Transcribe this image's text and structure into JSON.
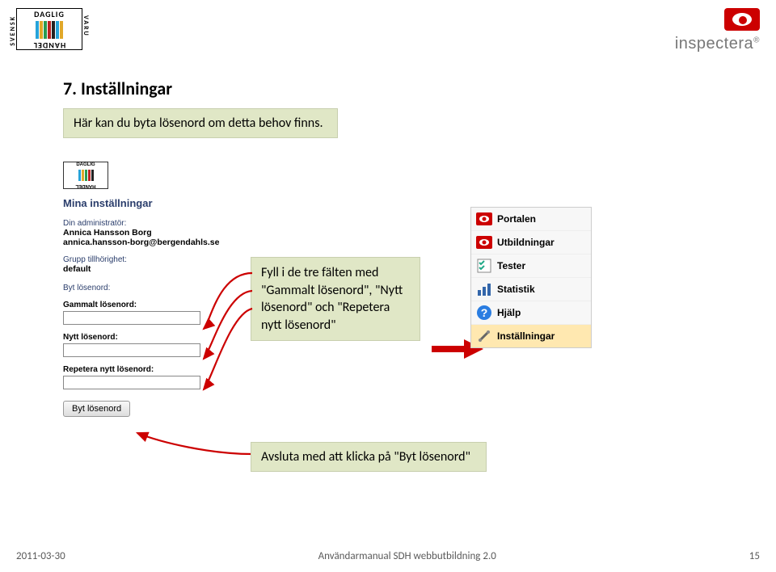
{
  "logos": {
    "sdh_top": "DAGLIG",
    "sdh_bottom": "HANDEL",
    "sdh_side_l": "SVENSK",
    "sdh_side_r": "VARU",
    "inspectera": "inspectera"
  },
  "page_title": "7.  Inställningar",
  "callouts": {
    "intro": "Här kan du byta lösenord om detta behov finns.",
    "fields": "Fyll i de tre fälten med \"Gammalt lösenord\", \"Nytt lösenord\" och \"Repetera nytt lösenord\"",
    "finish": "Avsluta med att klicka på \"Byt lösenord\""
  },
  "settings_panel": {
    "heading": "Mina inställningar",
    "admin_label": "Din administratör:",
    "admin_name": "Annica Hansson Borg",
    "admin_email": "annica.hansson-borg@bergendahls.se",
    "group_label": "Grupp tillhörighet:",
    "group_value": "default",
    "change_pw_label": "Byt lösenord:",
    "old_pw_label": "Gammalt lösenord:",
    "new_pw_label": "Nytt lösenord:",
    "repeat_pw_label": "Repetera nytt lösenord:",
    "submit_label": "Byt lösenord"
  },
  "menu": {
    "items": [
      {
        "label": "Portalen",
        "icon": "eye-icon"
      },
      {
        "label": "Utbildningar",
        "icon": "eye-icon"
      },
      {
        "label": "Tester",
        "icon": "checklist-icon"
      },
      {
        "label": "Statistik",
        "icon": "bar-chart-icon"
      },
      {
        "label": "Hjälp",
        "icon": "question-icon"
      },
      {
        "label": "Inställningar",
        "icon": "tools-icon"
      }
    ]
  },
  "footer": {
    "date": "2011-03-30",
    "doc_title": "Användarmanual SDH webbutbildning 2.0",
    "page_num": "15"
  }
}
